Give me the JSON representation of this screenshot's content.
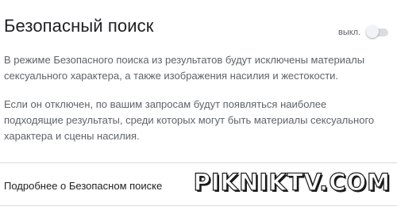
{
  "section": {
    "title": "Безопасный поиск",
    "toggle": {
      "state_label": "выкл.",
      "checked": false
    },
    "description": [
      "В режиме Безопасного поиска из результатов будут исключены материалы сексуального характера, а также изображения насилия и жестокости.",
      "Если он отключен, по вашим запросам будут появляться наиболее подходящие результаты, среди которых могут быть материалы сексуального характера и сцены насилия."
    ],
    "learn_more_label": "Подробнее о Безопасном поиске"
  },
  "watermark": "PIKNIKTV.COM",
  "colors": {
    "text_primary": "#202124",
    "text_secondary": "#5f6368",
    "divider": "#dadce0",
    "switch_track": "#dadce0",
    "switch_knob": "#f1f3f4"
  }
}
